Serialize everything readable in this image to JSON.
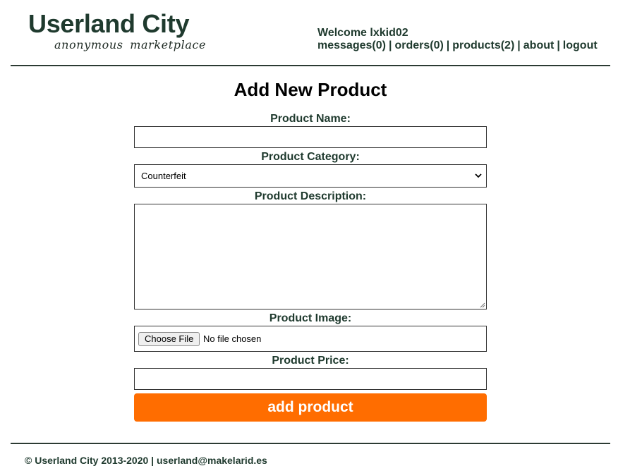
{
  "site": {
    "title": "Userland City",
    "tagline": "anonymous marketplace"
  },
  "user": {
    "welcome": "Welcome lxkid02"
  },
  "nav": {
    "messages": "messages(0)",
    "orders": "orders(0)",
    "products": "products(2)",
    "about": "about",
    "logout": "logout",
    "separator": "|"
  },
  "form": {
    "title": "Add New Product",
    "name_label": "Product Name:",
    "name_value": "",
    "category_label": "Product Category:",
    "category_selected": "Counterfeit",
    "description_label": "Product Description:",
    "description_value": "",
    "image_label": "Product Image:",
    "choose_file_label": "Choose File",
    "file_status": "No file chosen",
    "price_label": "Product Price:",
    "price_value": "",
    "submit_label": "add product"
  },
  "footer": {
    "text": "© Userland City 2013-2020 | userland@makelarid.es"
  },
  "colors": {
    "brand_text": "#1f3a2e",
    "submit_button": "#ff6d00",
    "rule": "#2c3b33"
  },
  "icons": {
    "select_arrow": "chevron-down-icon",
    "textarea_resize": "resize-handle-icon"
  }
}
